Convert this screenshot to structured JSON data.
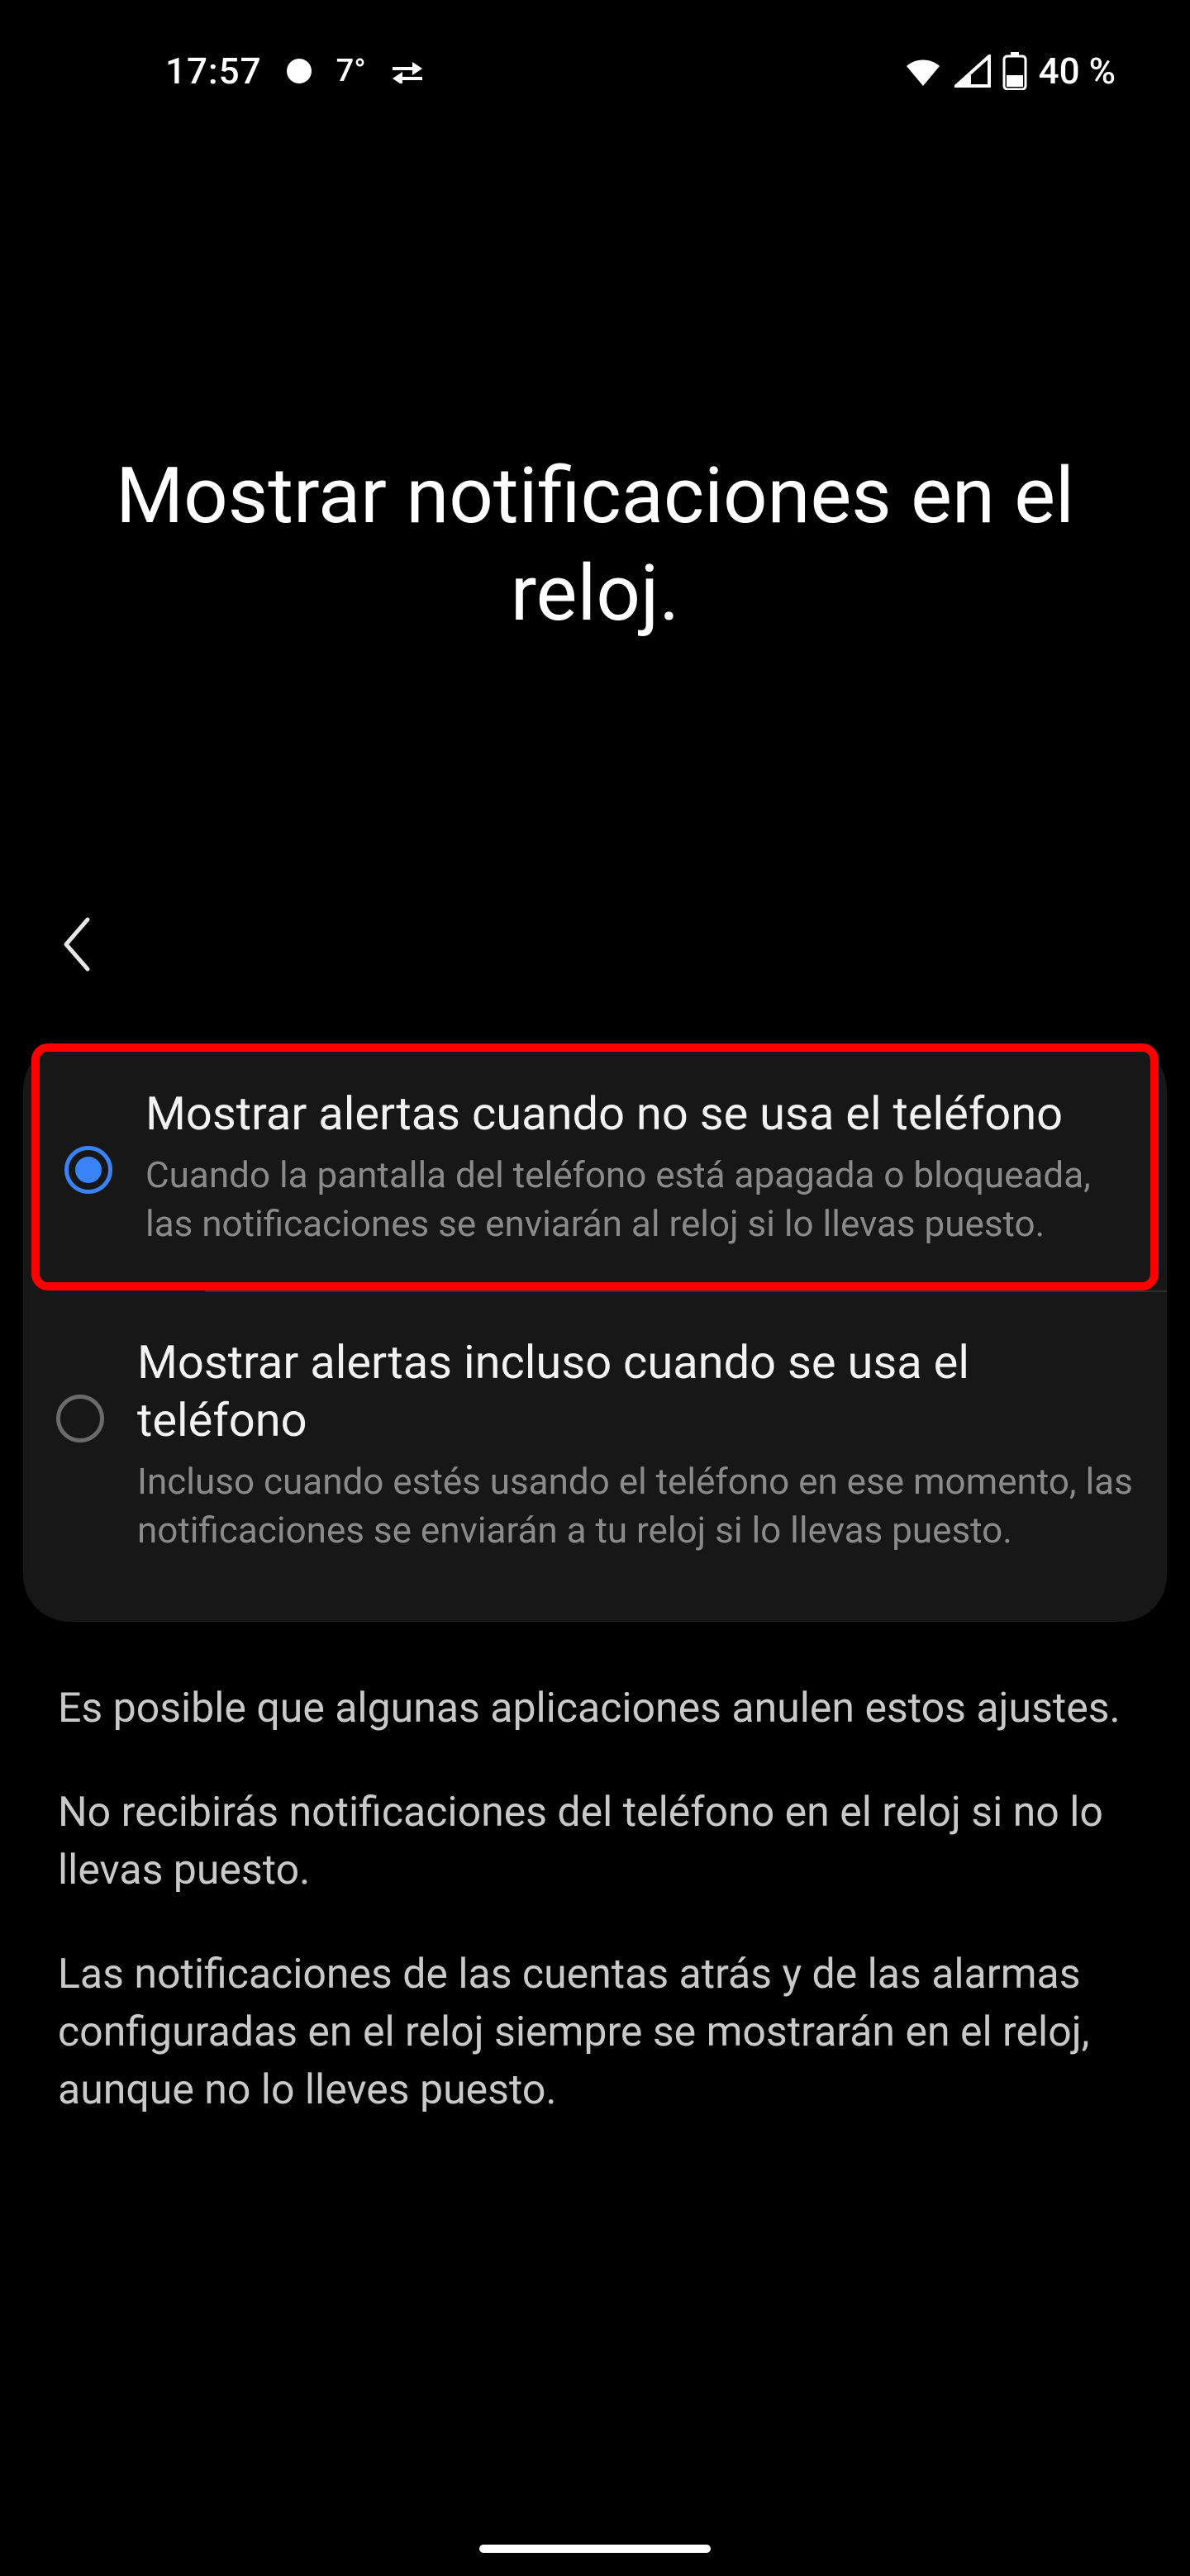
{
  "status": {
    "time": "17:57",
    "temp": "7°",
    "battery": "40 %"
  },
  "title": "Mostrar notificaciones en el reloj.",
  "options": [
    {
      "title": "Mostrar alertas cuando no se usa el teléfono",
      "desc": "Cuando la pantalla del teléfono está apagada o bloqueada, las notificaciones se enviarán al reloj si lo llevas puesto."
    },
    {
      "title": "Mostrar alertas incluso cuando se usa el teléfono",
      "desc": "Incluso cuando estés usando el teléfono en ese momento, las notificaciones se enviarán a tu reloj si lo llevas puesto."
    }
  ],
  "footer": {
    "p1": "Es posible que algunas aplicaciones anulen estos ajustes.",
    "p2": "No recibirás notificaciones del teléfono en el reloj si no lo llevas puesto.",
    "p3": "Las notificaciones de las cuentas atrás y de las alarmas configuradas en el reloj siempre se mostrarán en el reloj, aunque no lo lleves puesto."
  }
}
